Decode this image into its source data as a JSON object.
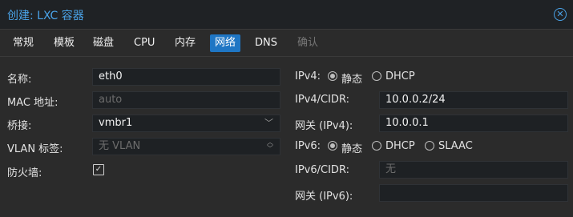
{
  "window": {
    "title": "创建: LXC 容器"
  },
  "tabs": [
    {
      "label": "常规"
    },
    {
      "label": "模板"
    },
    {
      "label": "磁盘"
    },
    {
      "label": "CPU"
    },
    {
      "label": "内存"
    },
    {
      "label": "网络"
    },
    {
      "label": "DNS"
    },
    {
      "label": "确认"
    }
  ],
  "left": {
    "name_label": "名称:",
    "name_value": "eth0",
    "mac_label": "MAC 地址:",
    "mac_placeholder": "auto",
    "bridge_label": "桥接:",
    "bridge_value": "vmbr1",
    "vlan_label": "VLAN 标签:",
    "vlan_placeholder": "无 VLAN",
    "firewall_label": "防火墙:",
    "firewall_checked": true
  },
  "right": {
    "ipv4_label": "IPv4:",
    "ipv4_static": "静态",
    "ipv4_dhcp": "DHCP",
    "ipv4_cidr_label": "IPv4/CIDR:",
    "ipv4_cidr_value": "10.0.0.2/24",
    "gw4_label": "网关 (IPv4):",
    "gw4_value": "10.0.0.1",
    "ipv6_label": "IPv6:",
    "ipv6_static": "静态",
    "ipv6_dhcp": "DHCP",
    "ipv6_slaac": "SLAAC",
    "ipv6_cidr_label": "IPv6/CIDR:",
    "ipv6_cidr_placeholder": "无",
    "gw6_label": "网关 (IPv6):"
  },
  "colors": {
    "accent": "#1f76c4",
    "title": "#4aa3e8",
    "background": "#2b2b2b",
    "field": "#1e2124"
  },
  "icons": {
    "close": "close-icon",
    "chevron": "chevron-down-icon",
    "spinner": "spinner-icon",
    "checkbox": "check-icon"
  }
}
